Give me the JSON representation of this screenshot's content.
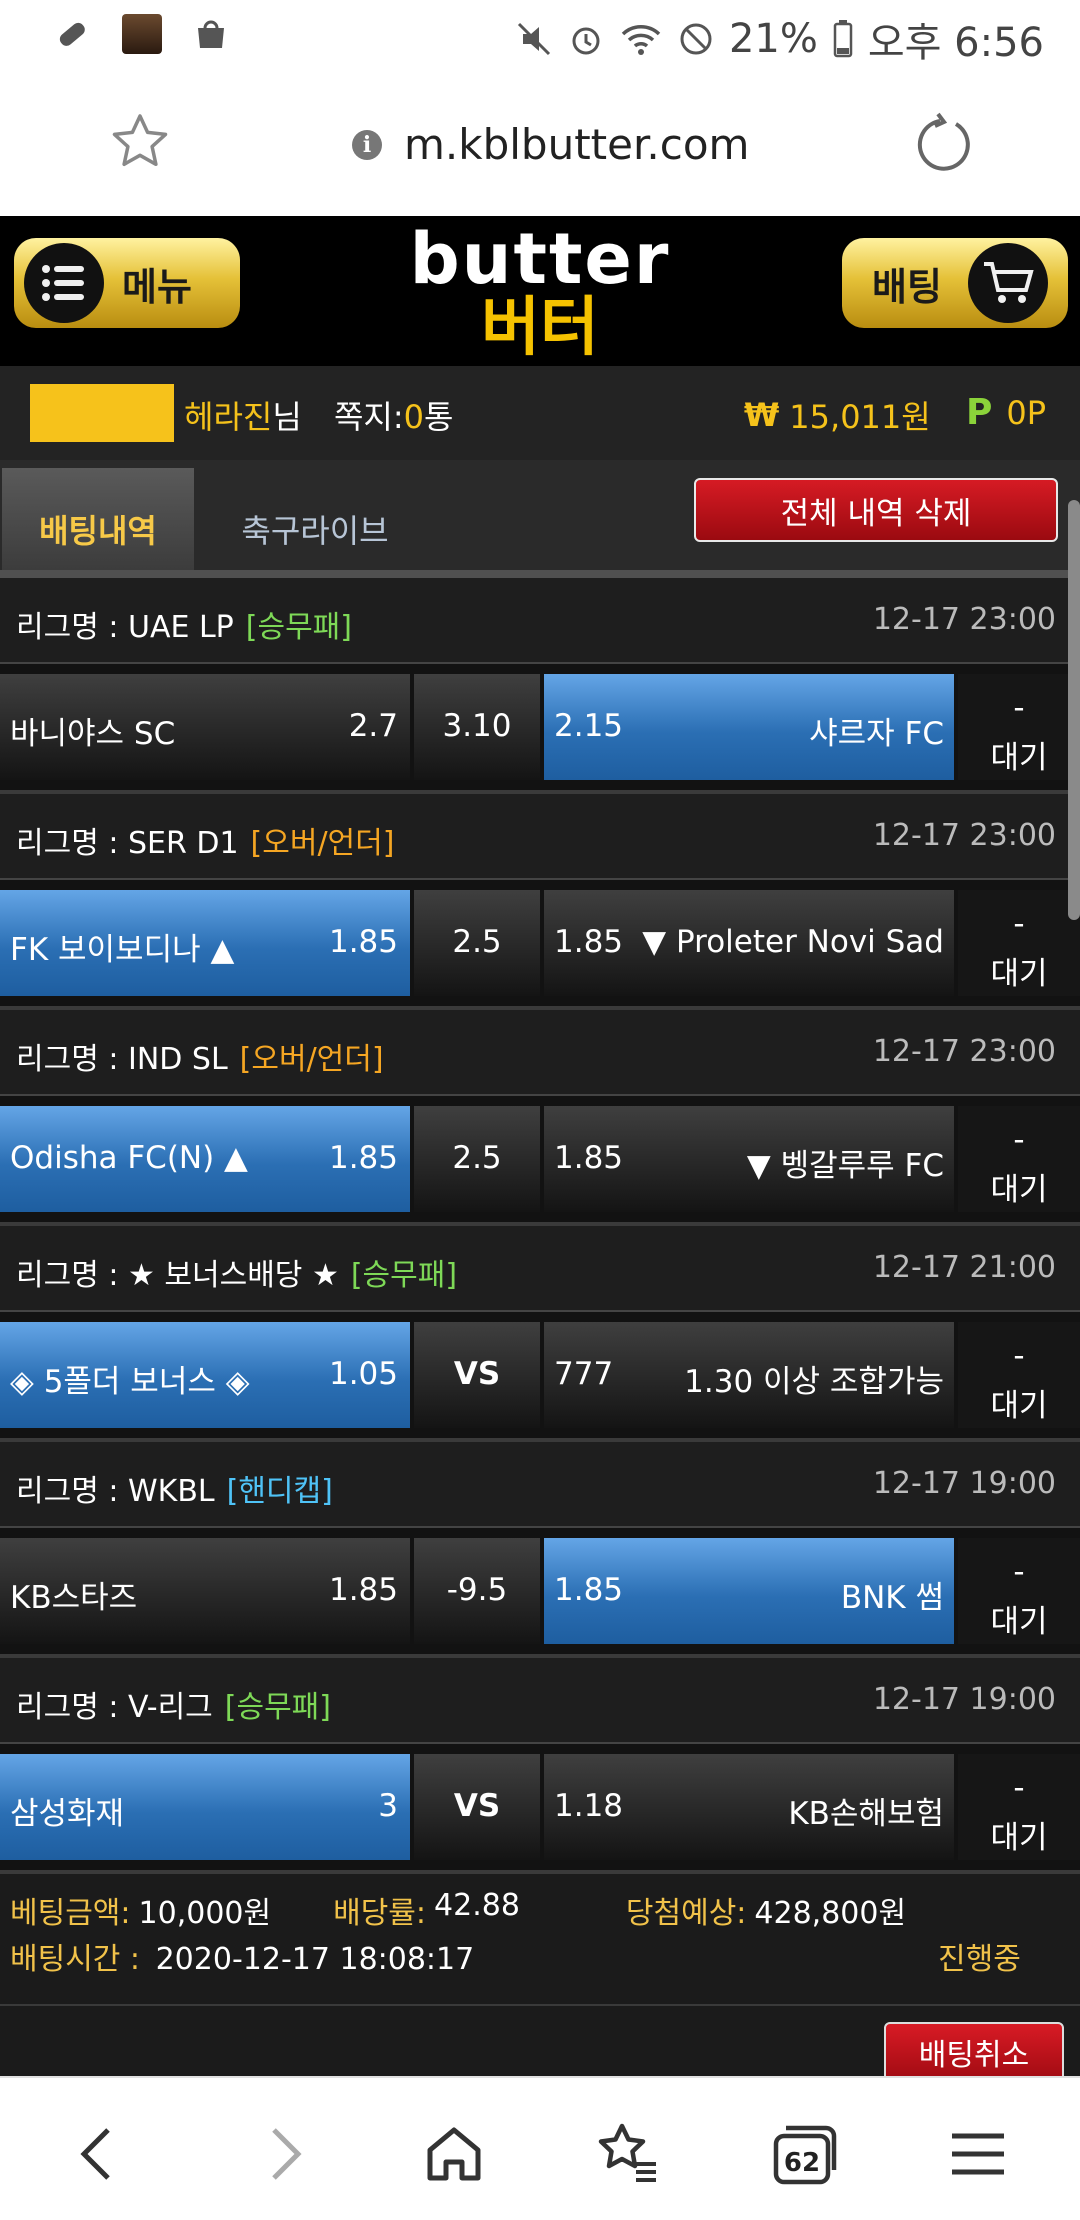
{
  "status_bar": {
    "battery": "21%",
    "time": "오후 6:56"
  },
  "browser": {
    "url": "m.kblbutter.com",
    "tab_count": "62"
  },
  "header": {
    "menu_label": "메뉴",
    "bet_label": "배팅",
    "logo_en": "butter",
    "logo_ko": "버터"
  },
  "user": {
    "name": "헤라진",
    "suffix": "님",
    "msg_label": "쪽지:",
    "msg_count": "0",
    "msg_unit": "통",
    "money_symbol": "₩",
    "money": "15,011원",
    "point_symbol": "P",
    "point": "0P"
  },
  "tabs": {
    "betting_history": "배팅내역",
    "soccer_live": "축구라이브",
    "delete_all": "전체 내역 삭제"
  },
  "bets": [
    {
      "league_label": "리그명 : UAE LP",
      "tag": "[승무패]",
      "tag_color": "#7ed957",
      "time": "12-17 23:00",
      "home": "바니야스 SC",
      "home_odd": "2.7",
      "mid": "3.10",
      "away_odd": "2.15",
      "away": "샤르자 FC",
      "selected": "away",
      "dash": "-",
      "status": "대기"
    },
    {
      "league_label": "리그명 : SER D1",
      "tag": "[오버/언더]",
      "tag_color": "#f5a623",
      "time": "12-17 23:00",
      "home": "FK 보이보디나 ▲",
      "home_odd": "1.85",
      "mid": "2.5",
      "away_odd": "1.85",
      "away": "▼ Proleter Novi Sad",
      "selected": "home",
      "dash": "-",
      "status": "대기"
    },
    {
      "league_label": "리그명 : IND SL",
      "tag": "[오버/언더]",
      "tag_color": "#f5a623",
      "time": "12-17 23:00",
      "home": "Odisha FC(N) ▲",
      "home_odd": "1.85",
      "mid": "2.5",
      "away_odd": "1.85",
      "away": "▼ 벵갈루루 FC",
      "selected": "home",
      "dash": "-",
      "status": "대기"
    },
    {
      "league_label": "리그명 : ★ 보너스배당 ★",
      "tag": "[승무패]",
      "tag_color": "#7ed957",
      "time": "12-17 21:00",
      "home": "◈ 5폴더 보너스 ◈",
      "home_odd": "1.05",
      "mid": "VS",
      "away_odd": "777",
      "away": "1.30 이상 조합가능",
      "selected": "home",
      "dash": "-",
      "status": "대기"
    },
    {
      "league_label": "리그명 : WKBL",
      "tag": "[핸디캡]",
      "tag_color": "#4fc3f7",
      "time": "12-17 19:00",
      "home": "KB스타즈",
      "home_odd": "1.85",
      "mid": "-9.5",
      "away_odd": "1.85",
      "away": "BNK 썸",
      "selected": "away",
      "dash": "-",
      "status": "대기"
    },
    {
      "league_label": "리그명 : V-리그",
      "tag": "[승무패]",
      "tag_color": "#7ed957",
      "time": "12-17 19:00",
      "home": "삼성화재",
      "home_odd": "3",
      "mid": "VS",
      "away_odd": "1.18",
      "away": "KB손해보험",
      "selected": "home",
      "dash": "-",
      "status": "대기"
    }
  ],
  "summary": {
    "bet_amount_label": "베팅금액:",
    "bet_amount": "10,000원",
    "odds_label": "배당률:",
    "odds": "42.88",
    "expected_label": "당첨예상:",
    "expected": "428,800원",
    "bet_time_label": "배팅시간 :",
    "bet_time": "2020-12-17 18:08:17",
    "progress": "진행중",
    "cancel": "배팅취소"
  }
}
